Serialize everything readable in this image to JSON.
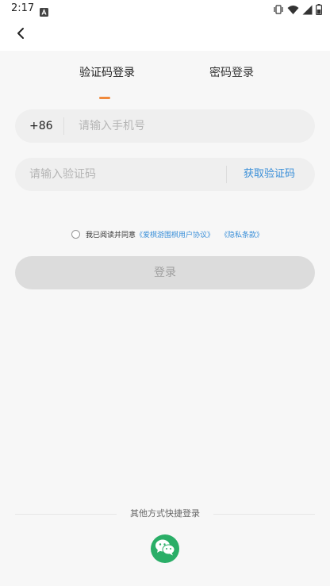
{
  "status_bar": {
    "time": "2:17",
    "app_icon": "text-a-icon",
    "icons": [
      "vibrate-icon",
      "wifi-icon",
      "signal-icon",
      "battery-icon"
    ]
  },
  "header": {
    "back_icon": "chevron-left-icon"
  },
  "tabs": {
    "code_login": "验证码登录",
    "password_login": "密码登录",
    "active": "code_login",
    "indicator_color": "#f08a3c"
  },
  "phone": {
    "country_code": "+86",
    "placeholder": "请输入手机号",
    "value": ""
  },
  "code": {
    "placeholder": "请输入验证码",
    "value": "",
    "get_code_label": "获取验证码"
  },
  "agreement": {
    "checked": false,
    "text": "我已阅读并同意",
    "user_agreement": "《爱棋游围棋用户协议》",
    "privacy_policy": "《隐私条款》"
  },
  "login": {
    "label": "登录"
  },
  "other_login": {
    "label": "其他方式快捷登录",
    "providers": [
      "wechat-icon"
    ]
  },
  "colors": {
    "accent": "#f08a3c",
    "link": "#3a8fd8",
    "wechat": "#2aae67",
    "background": "#f7f7f7"
  }
}
